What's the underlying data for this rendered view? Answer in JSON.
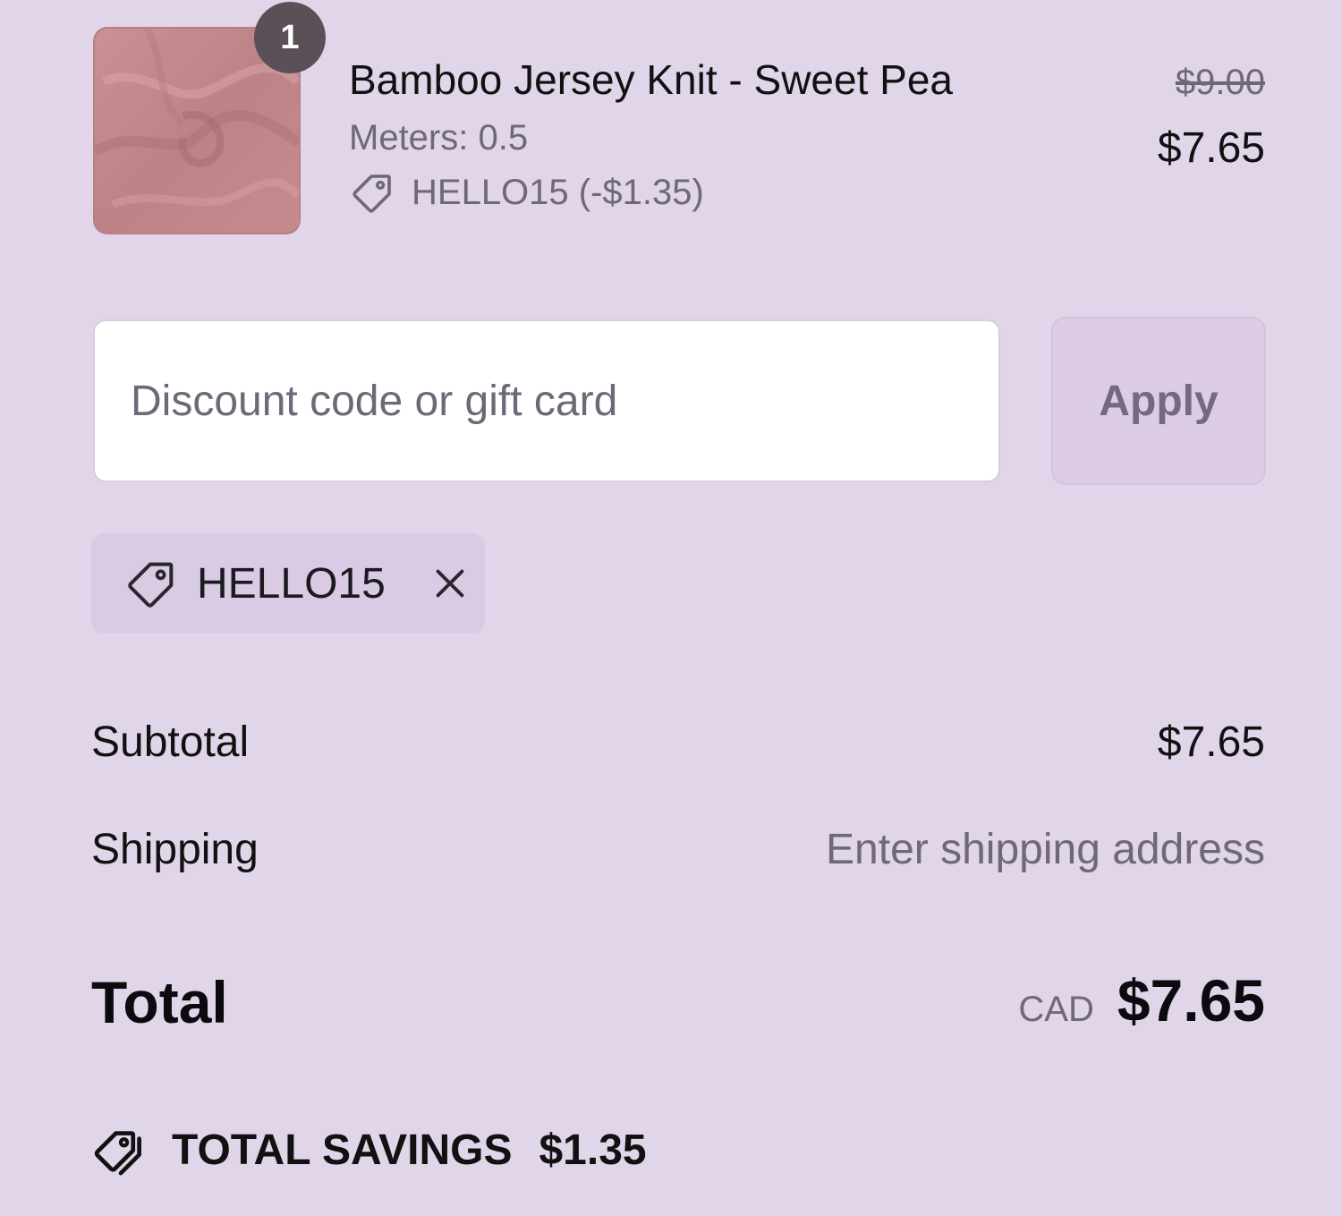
{
  "line_item": {
    "quantity": "1",
    "title": "Bamboo Jersey Knit - Sweet Pea",
    "variant": "Meters: 0.5",
    "discount": "HELLO15 (-$1.35)",
    "original_price": "$9.00",
    "price": "$7.65",
    "thumbnail_color": "#c4898d",
    "tag_icon": "tag-icon"
  },
  "discount_form": {
    "placeholder": "Discount code or gift card",
    "value": "",
    "apply_label": "Apply"
  },
  "applied_code": {
    "code": "HELLO15",
    "tag_icon": "tag-icon",
    "remove_icon": "close-icon"
  },
  "summary": {
    "subtotal_label": "Subtotal",
    "subtotal_value": "$7.65",
    "shipping_label": "Shipping",
    "shipping_value": "Enter shipping address",
    "total_label": "Total",
    "currency": "CAD",
    "total_value": "$7.65"
  },
  "savings": {
    "label": "TOTAL SAVINGS",
    "value": "$1.35",
    "icon": "tags-icon"
  },
  "colors": {
    "background": "#e1d5e9",
    "muted_text": "#6f6877",
    "badge": "#5b5057"
  }
}
